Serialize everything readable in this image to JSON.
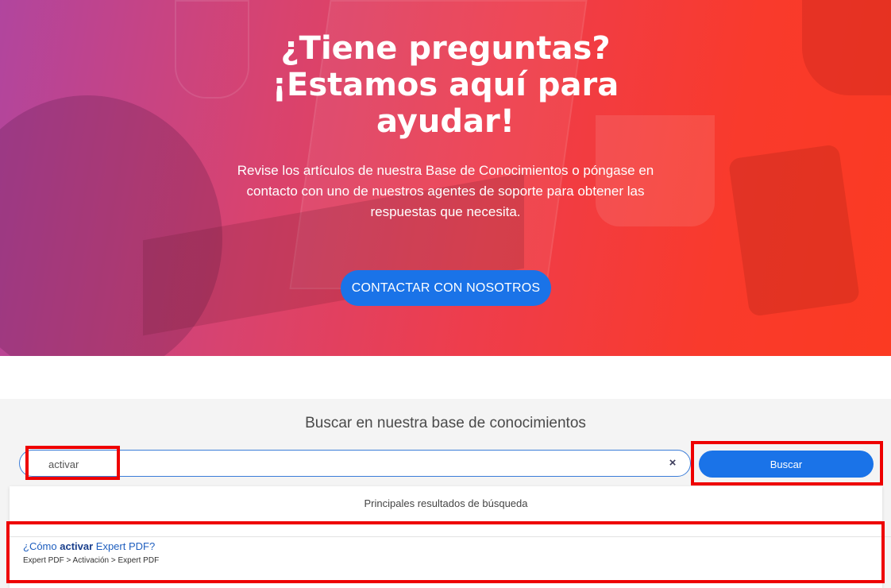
{
  "hero": {
    "title_line1": "¿Tiene preguntas?",
    "title_line2": "¡Estamos aquí para",
    "title_line3": "ayudar!",
    "description": "Revise los artículos de nuestra Base de Conocimientos o póngase en contacto con uno de nuestros agentes de soporte para obtener las respuestas que necesita.",
    "contact_button": "CONTACTAR CON NOSOTROS"
  },
  "search": {
    "heading": "Buscar en nuestra base de conocimientos",
    "query": "activar",
    "clear_icon": "×",
    "button_label": "Buscar"
  },
  "results": {
    "header": "Principales resultados de búsqueda",
    "items": [
      {
        "title_prefix": "¿Cómo ",
        "title_match": "activar",
        "title_suffix": " Expert PDF?",
        "path": "Expert PDF > Activación > Expert PDF"
      }
    ]
  },
  "colors": {
    "accent": "#1a73e8",
    "highlight": "#ee0000",
    "hero_gradient_start": "#b1459e",
    "hero_gradient_end": "#fb3a22"
  }
}
